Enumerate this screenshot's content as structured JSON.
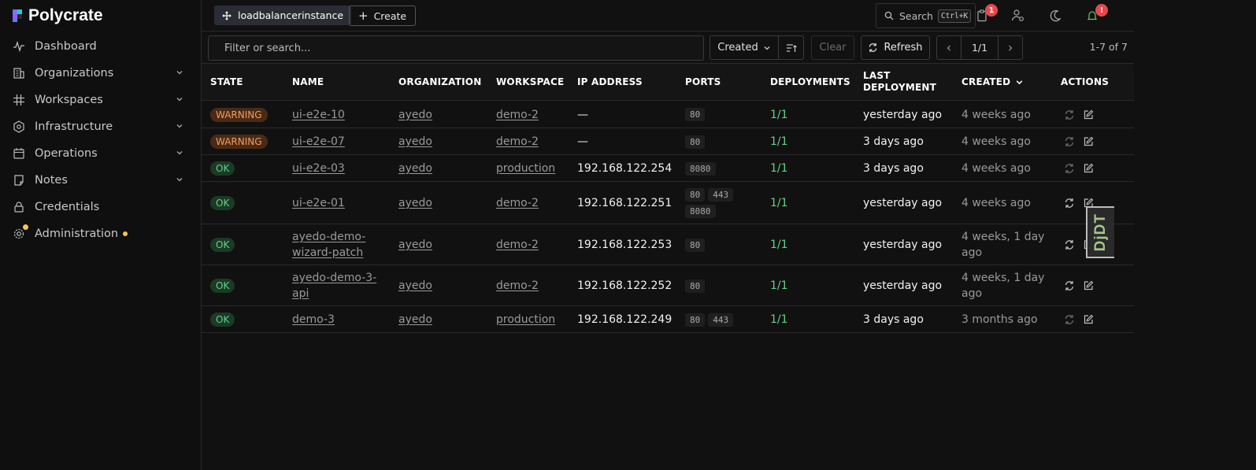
{
  "brand": {
    "title": "Polycrate"
  },
  "sidebar": {
    "items": [
      {
        "label": "Dashboard",
        "icon": "activity-icon",
        "expandable": false
      },
      {
        "label": "Organizations",
        "icon": "building-icon",
        "expandable": true
      },
      {
        "label": "Workspaces",
        "icon": "grid-icon",
        "expandable": true
      },
      {
        "label": "Infrastructure",
        "icon": "hexagon-icon",
        "expandable": true
      },
      {
        "label": "Operations",
        "icon": "calendar-icon",
        "expandable": true
      },
      {
        "label": "Notes",
        "icon": "note-icon",
        "expandable": true
      },
      {
        "label": "Credentials",
        "icon": "lock-icon",
        "expandable": false
      },
      {
        "label": "Administration",
        "icon": "gear-icon",
        "expandable": false,
        "has_dot": true
      }
    ]
  },
  "topbar": {
    "resource_type": "loadbalancerinstance",
    "create_label": "Create",
    "search_label": "Search",
    "search_shortcut": "Ctrl+K",
    "tasks_badge": "1",
    "alerts_badge": "!"
  },
  "toolbar": {
    "filter_placeholder": "Filter or search...",
    "sort_label": "Created",
    "clear_label": "Clear",
    "refresh_label": "Refresh",
    "page_label": "1/1",
    "count_label": "1-7 of 7"
  },
  "table": {
    "headers": {
      "state": "STATE",
      "name": "NAME",
      "organization": "ORGANIZATION",
      "workspace": "WORKSPACE",
      "ip": "IP ADDRESS",
      "ports": "PORTS",
      "deployments": "DEPLOYMENTS",
      "last_deployment_1": "LAST",
      "last_deployment_2": "DEPLOYMENT",
      "created": "CREATED",
      "actions": "ACTIONS"
    },
    "rows": [
      {
        "state": "WARNING",
        "name": "ui-e2e-10",
        "organization": "ayedo",
        "workspace": "demo-2",
        "ip": "—",
        "ports": [
          "80"
        ],
        "deployments": "1/1",
        "last_deployment": "yesterday ago",
        "created": "4 weeks ago"
      },
      {
        "state": "WARNING",
        "name": "ui-e2e-07",
        "organization": "ayedo",
        "workspace": "demo-2",
        "ip": "—",
        "ports": [
          "80"
        ],
        "deployments": "1/1",
        "last_deployment": "3 days ago",
        "created": "4 weeks ago"
      },
      {
        "state": "OK",
        "name": "ui-e2e-03",
        "organization": "ayedo",
        "workspace": "production",
        "ip": "192.168.122.254",
        "ports": [
          "8080"
        ],
        "deployments": "1/1",
        "last_deployment": "3 days ago",
        "created": "4 weeks ago"
      },
      {
        "state": "OK",
        "name": "ui-e2e-01",
        "organization": "ayedo",
        "workspace": "demo-2",
        "ip": "192.168.122.251",
        "ports": [
          "80",
          "443",
          "8080"
        ],
        "deployments": "1/1",
        "last_deployment": "yesterday ago",
        "created": "4 weeks ago"
      },
      {
        "state": "OK",
        "name": "ayedo-demo-wizard-patch",
        "organization": "ayedo",
        "workspace": "demo-2",
        "ip": "192.168.122.253",
        "ports": [
          "80"
        ],
        "deployments": "1/1",
        "last_deployment": "yesterday ago",
        "created": "4 weeks, 1 day ago"
      },
      {
        "state": "OK",
        "name": "ayedo-demo-3-api",
        "organization": "ayedo",
        "workspace": "demo-2",
        "ip": "192.168.122.252",
        "ports": [
          "80"
        ],
        "deployments": "1/1",
        "last_deployment": "yesterday ago",
        "created": "4 weeks, 1 day ago"
      },
      {
        "state": "OK",
        "name": "demo-3",
        "organization": "ayedo",
        "workspace": "production",
        "ip": "192.168.122.249",
        "ports": [
          "80",
          "443"
        ],
        "deployments": "1/1",
        "last_deployment": "3 days ago",
        "created": "3 months ago"
      }
    ]
  },
  "debug_toolbar": {
    "label": "DjDT"
  },
  "colors": {
    "warning": "#f29e5c",
    "ok": "#62d18b",
    "badge": "#e5484d",
    "dot": "#f6c744"
  }
}
